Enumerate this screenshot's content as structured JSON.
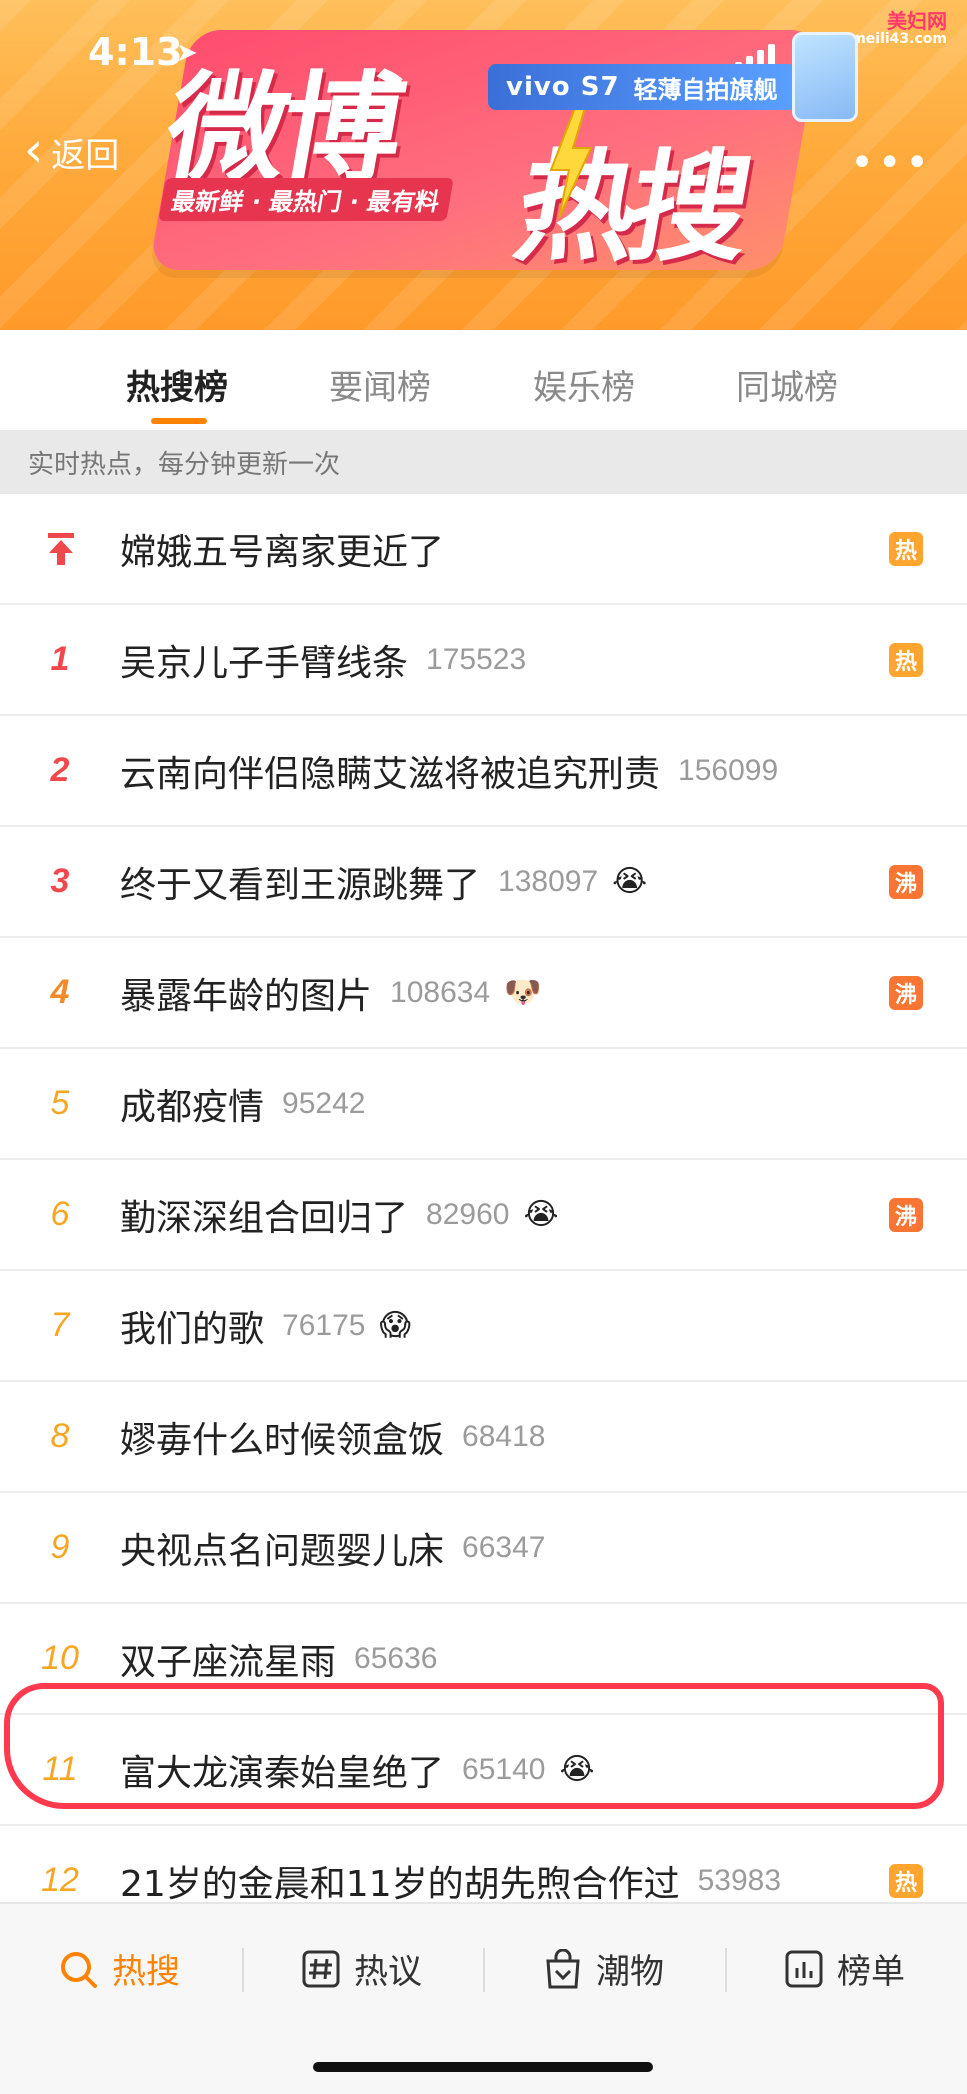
{
  "status": {
    "time": "4:13"
  },
  "header": {
    "back_label": "返回",
    "banner_title_part1": "微博",
    "banner_title_part2": "热搜",
    "banner_tagline": "最新鲜 · 最热门 · 最有料",
    "ad_brand": "vivo S7",
    "ad_text": "轻薄自拍旗舰",
    "watermark_line1": "美妇网",
    "watermark_line2": "meili43.com"
  },
  "tabs": [
    {
      "label": "热搜榜",
      "active": true
    },
    {
      "label": "要闻榜",
      "active": false
    },
    {
      "label": "娱乐榜",
      "active": false
    },
    {
      "label": "同城榜",
      "active": false
    }
  ],
  "subheader": "实时热点，每分钟更新一次",
  "list": [
    {
      "rank": "",
      "title": "嫦娥五号离家更近了",
      "count": "",
      "emoji": "",
      "tag": "热"
    },
    {
      "rank": "1",
      "title": "吴京儿子手臂线条",
      "count": "175523",
      "emoji": "",
      "tag": "热"
    },
    {
      "rank": "2",
      "title": "云南向伴侣隐瞒艾滋将被追究刑责",
      "count": "156099",
      "emoji": "",
      "tag": ""
    },
    {
      "rank": "3",
      "title": "终于又看到王源跳舞了",
      "count": "138097",
      "emoji": "😭",
      "tag": "沸"
    },
    {
      "rank": "4",
      "title": "暴露年龄的图片",
      "count": "108634",
      "emoji": "🐶",
      "tag": "沸"
    },
    {
      "rank": "5",
      "title": "成都疫情",
      "count": "95242",
      "emoji": "",
      "tag": ""
    },
    {
      "rank": "6",
      "title": "勤深深组合回归了",
      "count": "82960",
      "emoji": "😭",
      "tag": "沸"
    },
    {
      "rank": "7",
      "title": "我们的歌",
      "count": "76175",
      "emoji": "😱",
      "tag": ""
    },
    {
      "rank": "8",
      "title": "嫪毐什么时候领盒饭",
      "count": "68418",
      "emoji": "",
      "tag": ""
    },
    {
      "rank": "9",
      "title": "央视点名问题婴儿床",
      "count": "66347",
      "emoji": "",
      "tag": ""
    },
    {
      "rank": "10",
      "title": "双子座流星雨",
      "count": "65636",
      "emoji": "",
      "tag": ""
    },
    {
      "rank": "11",
      "title": "富大龙演秦始皇绝了",
      "count": "65140",
      "emoji": "😭",
      "tag": ""
    },
    {
      "rank": "12",
      "title": "21岁的金晨和11岁的胡先煦合作过",
      "count": "53983",
      "emoji": "",
      "tag": "热"
    }
  ],
  "bottom_nav": [
    {
      "label": "热搜",
      "icon": "search-icon",
      "active": true
    },
    {
      "label": "热议",
      "icon": "hashtag-icon",
      "active": false
    },
    {
      "label": "潮物",
      "icon": "bag-icon",
      "active": false
    },
    {
      "label": "榜单",
      "icon": "chart-icon",
      "active": false
    }
  ],
  "colors": {
    "accent": "#ff8200",
    "rank_top": "#f0494d",
    "rank_mid": "#f48a27",
    "tag_hot": "#fea530",
    "tag_boil": "#f87533",
    "highlight": "#ff3a4f"
  }
}
